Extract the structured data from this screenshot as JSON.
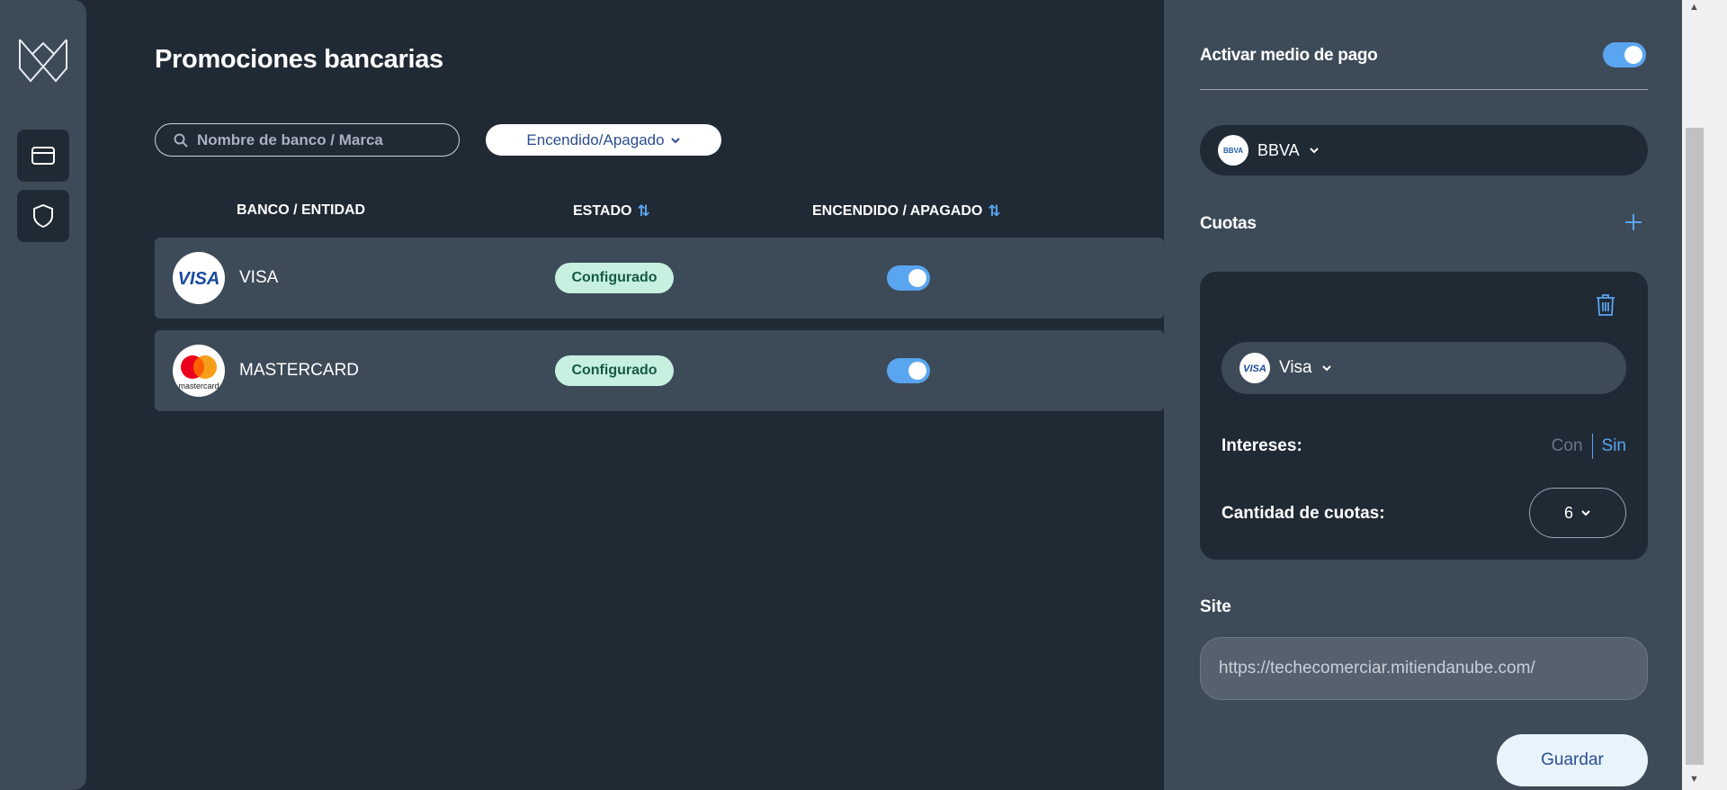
{
  "page": {
    "title": "Promociones bancarias",
    "search_placeholder": "Nombre de banco / Marca",
    "filter_label": "Encendido/Apagado"
  },
  "table": {
    "headers": {
      "bank": "BANCO / ENTIDAD",
      "status": "ESTADO",
      "onoff": "ENCENDIDO / APAGADO"
    },
    "rows": [
      {
        "name": "VISA",
        "status": "Configurado",
        "enabled": true
      },
      {
        "name": "MASTERCARD",
        "status": "Configurado",
        "enabled": true
      }
    ]
  },
  "panel": {
    "title": "Activar medio de pago",
    "active": true,
    "bank": {
      "name": "BBVA",
      "logo_text": "BBVA"
    },
    "cuotas_title": "Cuotas",
    "card": {
      "name": "Visa",
      "logo_text": "VISA"
    },
    "intereses_label": "Intereses:",
    "intereses_con": "Con",
    "intereses_sin": "Sin",
    "cantidad_label": "Cantidad de cuotas:",
    "cantidad_value": "6",
    "site_label": "Site",
    "site_value": "https://techecomerciar.mitiendanube.com/",
    "save_label": "Guardar"
  },
  "icons": {
    "logo": "brand-logo-icon",
    "nav": [
      "credit-card-icon",
      "shield-icon"
    ],
    "search": "search-icon",
    "sort": "sort-icon",
    "add": "plus-icon",
    "delete": "trash-icon",
    "chevron": "chevron-down-icon"
  },
  "colors": {
    "background": "#202a35",
    "surface": "#3d4a58",
    "accent": "#5aa5f0",
    "badge_bg": "#c7f0e1",
    "badge_text": "#175b3f"
  }
}
